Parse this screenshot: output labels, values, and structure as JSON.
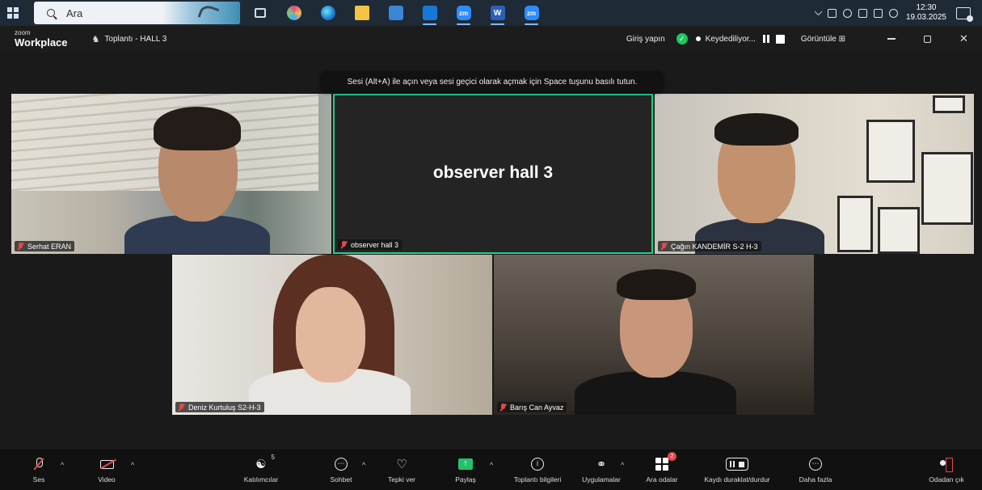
{
  "taskbar": {
    "search_placeholder": "Ara",
    "icons": [
      {
        "name": "task-view-icon",
        "label": ""
      },
      {
        "name": "copilot-icon",
        "label": ""
      },
      {
        "name": "edge-icon",
        "label": ""
      },
      {
        "name": "file-explorer-icon",
        "label": ""
      },
      {
        "name": "store-icon",
        "label": ""
      },
      {
        "name": "outlook-icon",
        "label": ""
      },
      {
        "name": "zoom-app-icon",
        "label": "zm"
      },
      {
        "name": "word-icon",
        "label": "W"
      },
      {
        "name": "zoom-app-icon",
        "label": "zm"
      }
    ],
    "clock_time": "12:30",
    "clock_date": "19.03.2025"
  },
  "zoom": {
    "logo_top": "zoom",
    "logo_bottom": "Workplace",
    "meeting_title": "Toplantı - HALL 3",
    "signin": "Giriş yapın",
    "recording": "Keydediliyor...",
    "view": "Görüntüle"
  },
  "hint": "Sesi (Alt+A) ile açın veya sesi geçici olarak açmak için Space tuşunu basılı tutun.",
  "tiles": [
    {
      "name": "Serhat ERAN"
    },
    {
      "name": "observer hall 3",
      "avatar_text": "observer hall 3"
    },
    {
      "name": "Çağın KANDEMİR S-2 H-3"
    },
    {
      "name": "Deniz Kurtuluş S2-H-3"
    },
    {
      "name": "Barış Can Ayvaz"
    }
  ],
  "toolbar": {
    "audio": "Ses",
    "video": "Video",
    "participants": "Katılımcılar",
    "participants_count": "5",
    "chat": "Sohbet",
    "react": "Tepki ver",
    "share": "Paylaş",
    "info": "Toplantı bilgileri",
    "apps": "Uygulamalar",
    "breakout": "Ara odalar",
    "breakout_badge": "2",
    "record": "Kaydı duraklat/durdur",
    "more": "Daha fazla",
    "leave": "Odadan çık"
  },
  "colors": {
    "active_speaker_border": "#23d18b",
    "muted_red": "#e5484d",
    "share_green": "#23c16b",
    "zoom_blue": "#2d8cff"
  }
}
